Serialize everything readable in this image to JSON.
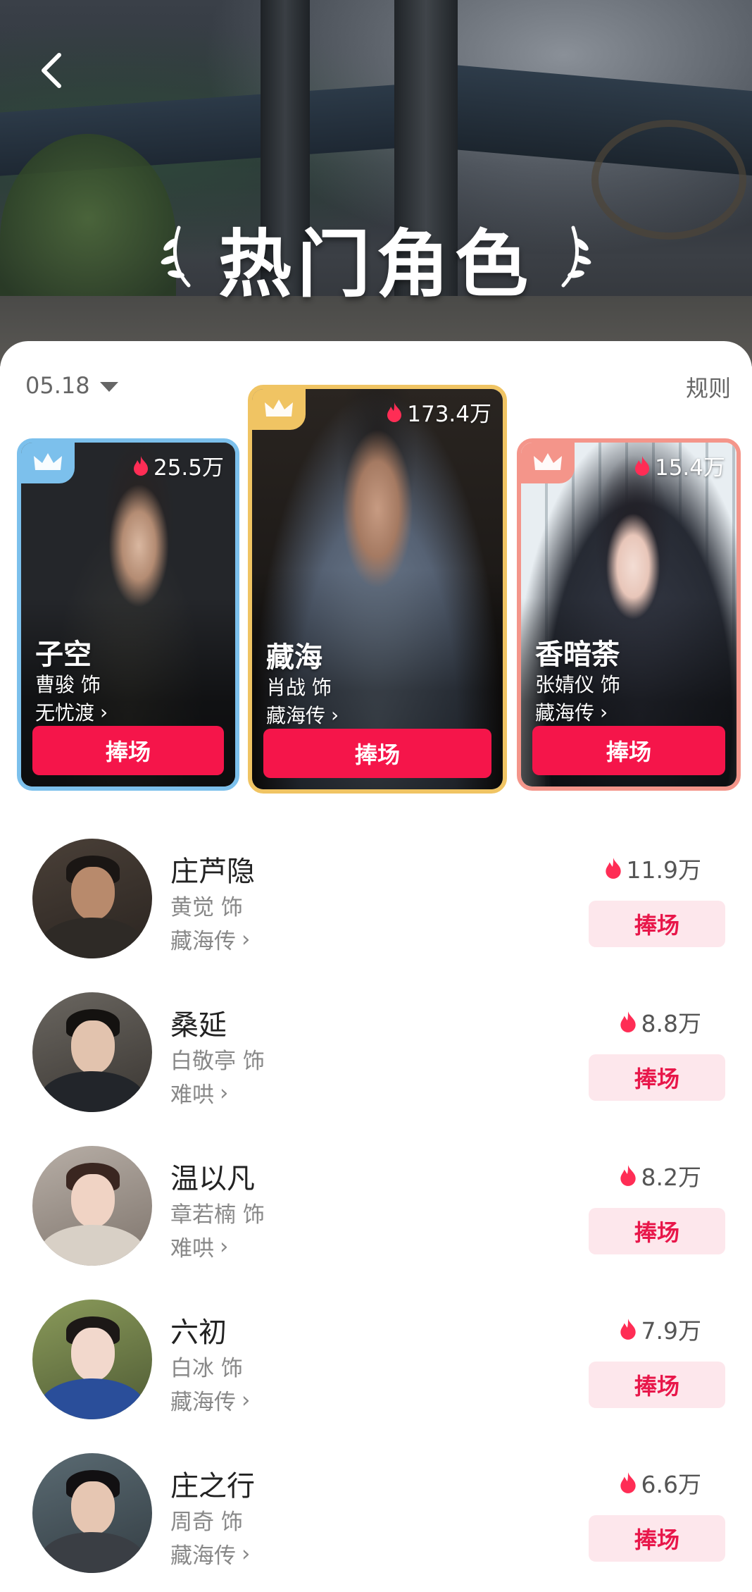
{
  "header": {
    "title": "热门角色",
    "back_icon": "chevron-left-icon"
  },
  "filter": {
    "date": "05.18",
    "rules_label": "规则"
  },
  "colors": {
    "accent": "#f5154a",
    "soft_button_bg": "#fde7ec",
    "rank1_border": "#f0c463",
    "rank2_border": "#7cc0ec",
    "rank3_border": "#f4958a"
  },
  "top3": [
    {
      "rank": 2,
      "name": "子空",
      "actor": "曹骏 饰",
      "show": "无忧渡",
      "heat": "25.5万",
      "button": "捧场"
    },
    {
      "rank": 1,
      "name": "藏海",
      "actor": "肖战 饰",
      "show": "藏海传",
      "heat": "173.4万",
      "button": "捧场"
    },
    {
      "rank": 3,
      "name": "香暗荼",
      "actor": "张婧仪 饰",
      "show": "藏海传",
      "heat": "15.4万",
      "button": "捧场"
    }
  ],
  "list": [
    {
      "name": "庄芦隐",
      "actor": "黄觉 饰",
      "show": "藏海传",
      "heat": "11.9万",
      "button": "捧场"
    },
    {
      "name": "桑延",
      "actor": "白敬亭 饰",
      "show": "难哄",
      "heat": "8.8万",
      "button": "捧场"
    },
    {
      "name": "温以凡",
      "actor": "章若楠 饰",
      "show": "难哄",
      "heat": "8.2万",
      "button": "捧场"
    },
    {
      "name": "六初",
      "actor": "白冰 饰",
      "show": "藏海传",
      "heat": "7.9万",
      "button": "捧场"
    },
    {
      "name": "庄之行",
      "actor": "周奇 饰",
      "show": "藏海传",
      "heat": "6.6万",
      "button": "捧场"
    }
  ]
}
